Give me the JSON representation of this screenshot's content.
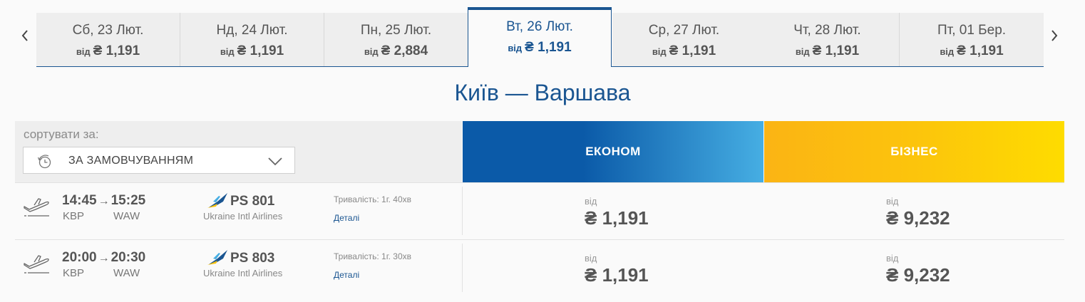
{
  "carousel": {
    "dates": [
      {
        "day": "Сб, 23 Лют.",
        "from": "від",
        "price": "₴ 1,191",
        "active": false
      },
      {
        "day": "Нд, 24 Лют.",
        "from": "від",
        "price": "₴ 1,191",
        "active": false
      },
      {
        "day": "Пн, 25 Лют.",
        "from": "від",
        "price": "₴ 2,884",
        "active": false
      },
      {
        "day": "Вт, 26 Лют.",
        "from": "від",
        "price": "₴ 1,191",
        "active": true
      },
      {
        "day": "Ср, 27 Лют.",
        "from": "від",
        "price": "₴ 1,191",
        "active": false
      },
      {
        "day": "Чт, 28 Лют.",
        "from": "від",
        "price": "₴ 1,191",
        "active": false
      },
      {
        "day": "Пт, 01 Бер.",
        "from": "від",
        "price": "₴ 1,191",
        "active": false
      }
    ],
    "prev_icon": "chevron-left-icon",
    "next_icon": "chevron-right-icon"
  },
  "route_title": "Київ — Варшава",
  "sort": {
    "label": "сортувати за:",
    "value": "ЗА ЗАМОВЧУВАННЯМ",
    "icon": "clock-icon"
  },
  "fare_classes": {
    "economy": "ЕКОНОМ",
    "business": "БІЗНЕС"
  },
  "flights": [
    {
      "dep_time": "14:45",
      "arr_time": "15:25",
      "dep_code": "KBP",
      "arr_code": "WAW",
      "flight_no": "PS 801",
      "airline": "Ukraine Intl Airlines",
      "duration": "Тривалість: 1г. 40хв",
      "details": "Деталі",
      "economy_from": "від",
      "economy_price": "₴ 1,191",
      "business_from": "від",
      "business_price": "₴ 9,232"
    },
    {
      "dep_time": "20:00",
      "arr_time": "20:30",
      "dep_code": "KBP",
      "arr_code": "WAW",
      "flight_no": "PS 803",
      "airline": "Ukraine Intl Airlines",
      "duration": "Тривалість: 1г. 30хв",
      "details": "Деталі",
      "economy_from": "від",
      "economy_price": "₴ 1,191",
      "business_from": "від",
      "business_price": "₴ 9,232"
    }
  ],
  "colors": {
    "brand_blue": "#1a5591",
    "economy_start": "#0b5aa8",
    "economy_end": "#46aee3",
    "business_start": "#fbb414",
    "business_end": "#fedc00"
  }
}
